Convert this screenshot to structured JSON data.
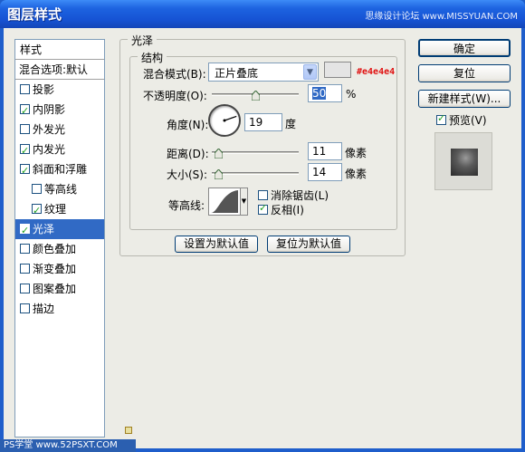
{
  "window": {
    "title": "图层样式",
    "watermark_top": "思缘设计论坛 www.MISSYUAN.COM",
    "watermark_bottom": "PS学堂 www.52PSXT.COM"
  },
  "sidebar": {
    "header": "样式",
    "blend_options": "混合选项:默认",
    "items": [
      {
        "label": "投影",
        "checked": false,
        "sub": false
      },
      {
        "label": "内阴影",
        "checked": true,
        "sub": false
      },
      {
        "label": "外发光",
        "checked": false,
        "sub": false
      },
      {
        "label": "内发光",
        "checked": true,
        "sub": false
      },
      {
        "label": "斜面和浮雕",
        "checked": true,
        "sub": false
      },
      {
        "label": "等高线",
        "checked": false,
        "sub": true
      },
      {
        "label": "纹理",
        "checked": true,
        "sub": true
      },
      {
        "label": "光泽",
        "checked": true,
        "sub": false,
        "selected": true
      },
      {
        "label": "颜色叠加",
        "checked": false,
        "sub": false
      },
      {
        "label": "渐变叠加",
        "checked": false,
        "sub": false
      },
      {
        "label": "图案叠加",
        "checked": false,
        "sub": false
      },
      {
        "label": "描边",
        "checked": false,
        "sub": false
      }
    ]
  },
  "satin": {
    "group_title": "光泽",
    "structure_title": "结构",
    "blend_mode_label": "混合模式(B):",
    "blend_mode_value": "正片叠底",
    "color_hex_label": "#e4e4e4",
    "color": "#e4e4e4",
    "opacity_label": "不透明度(O):",
    "opacity_value": "50",
    "opacity_fraction": 0.5,
    "percent": "%",
    "angle_label": "角度(N):",
    "angle_value": "19",
    "angle_unit": "度",
    "distance_label": "距离(D):",
    "distance_value": "11",
    "distance_unit": "像素",
    "size_label": "大小(S):",
    "size_value": "14",
    "size_unit": "像素",
    "contour_label": "等高线:",
    "antialias_label": "消除锯齿(L)",
    "antialias_checked": false,
    "invert_label": "反相(I)",
    "invert_checked": true,
    "set_default": "设置为默认值",
    "reset_default": "复位为默认值"
  },
  "right_panel": {
    "ok": "确定",
    "reset": "复位",
    "new_style": "新建样式(W)...",
    "preview_label": "预览(V)",
    "preview_checked": true
  },
  "colors": {
    "selection": "#316ac5",
    "titlebar": "#1d63e0",
    "hex_label": "#e01010"
  }
}
